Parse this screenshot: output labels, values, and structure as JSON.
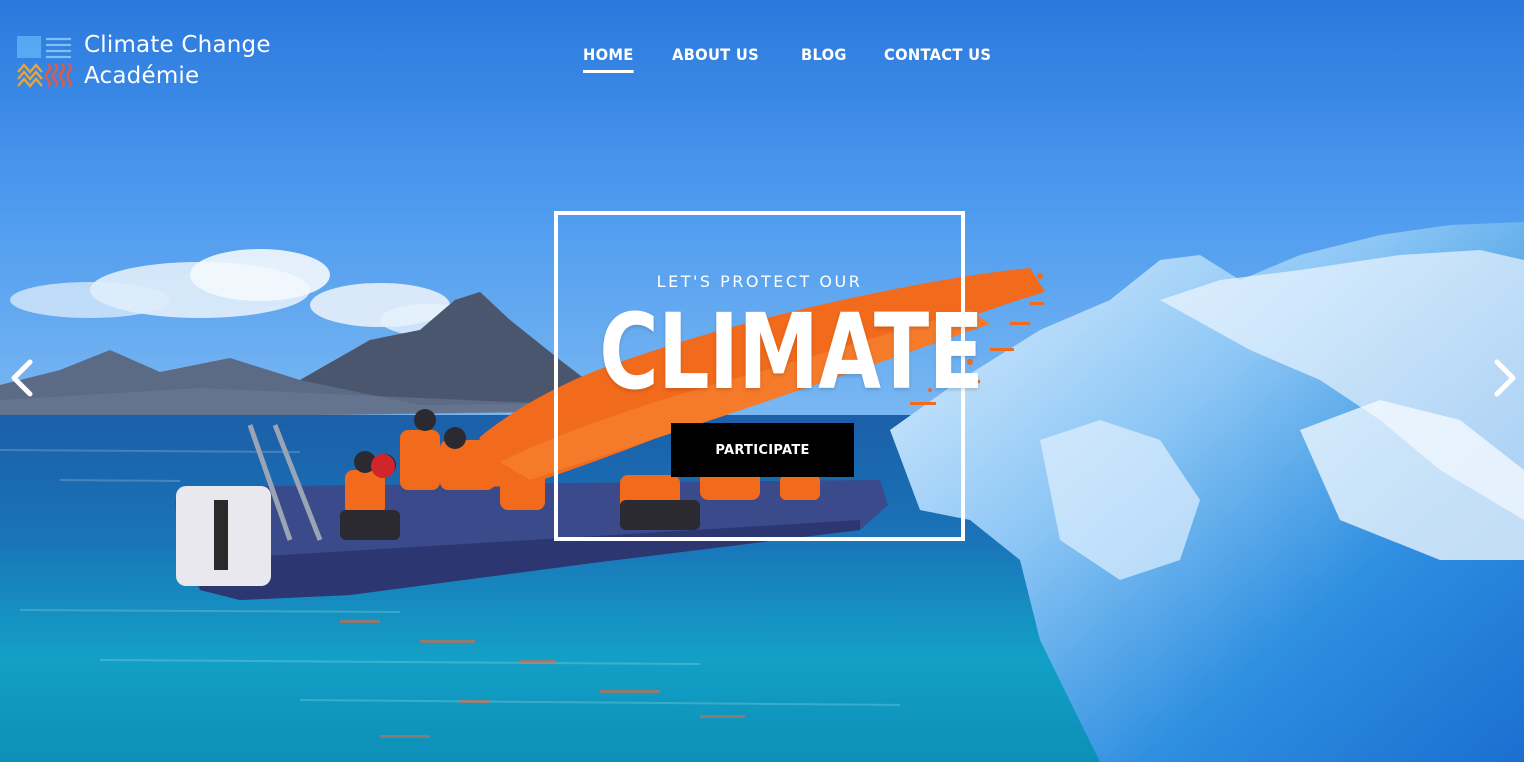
{
  "brand": {
    "line1": "Climate Change",
    "line2": "Académie"
  },
  "nav": {
    "items": [
      {
        "label": "HOME",
        "active": true
      },
      {
        "label": "ABOUT US",
        "active": false
      },
      {
        "label": "BLOG",
        "active": false
      },
      {
        "label": "CONTACT US",
        "active": false
      }
    ]
  },
  "hero": {
    "subtitle": "LET'S PROTECT OUR",
    "title": "CLIMATE",
    "cta_label": "PARTICIPATE"
  },
  "slider": {
    "prev_icon": "chevron-left-icon",
    "next_icon": "chevron-right-icon"
  },
  "colors": {
    "accent_orange": "#f26a1b",
    "sky_blue": "#3a8ef0",
    "water_teal": "#0fa6c8",
    "cta_background": "#000000",
    "text": "#ffffff"
  }
}
